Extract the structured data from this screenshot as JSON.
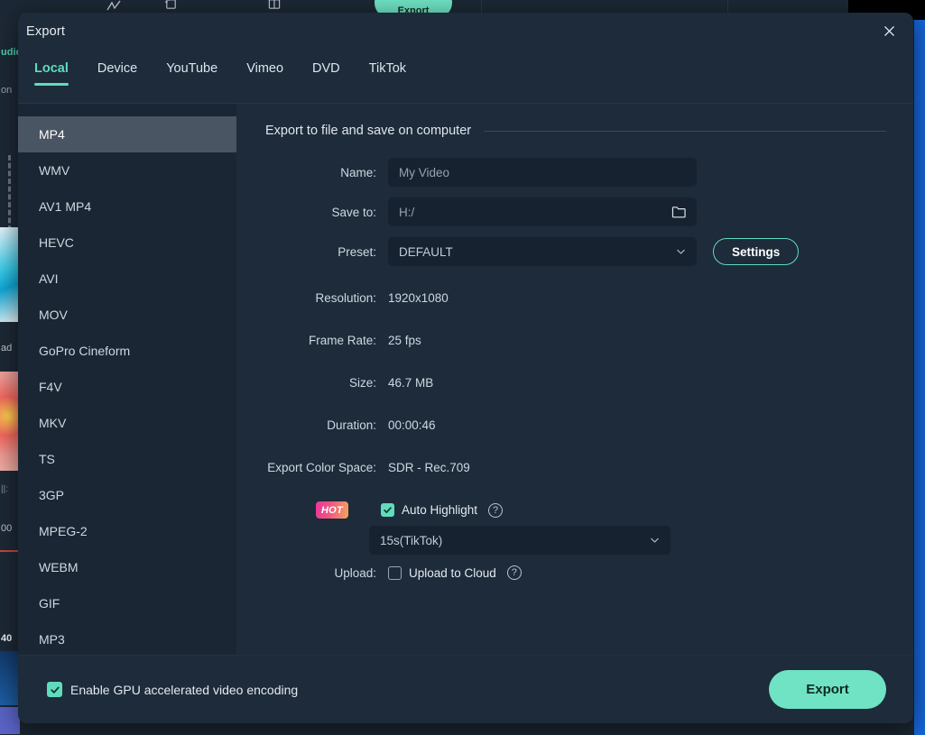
{
  "background": {
    "toolbar_icons": [
      "speed-curve-icon",
      "crop-icon",
      "split-screen-icon"
    ],
    "export_pill_label": "Export",
    "rail": {
      "audio_label": "udio",
      "on_label": "on",
      "ad_label": "ad",
      "bars_label": "||:",
      "time_label": "00",
      "marker_label": "40"
    }
  },
  "dialog": {
    "title": "Export",
    "close_icon": "close-icon"
  },
  "tabs": [
    {
      "label": "Local",
      "active": true
    },
    {
      "label": "Device",
      "active": false
    },
    {
      "label": "YouTube",
      "active": false
    },
    {
      "label": "Vimeo",
      "active": false
    },
    {
      "label": "DVD",
      "active": false
    },
    {
      "label": "TikTok",
      "active": false
    }
  ],
  "formats": [
    {
      "label": "MP4",
      "selected": true
    },
    {
      "label": "WMV",
      "selected": false
    },
    {
      "label": "AV1 MP4",
      "selected": false
    },
    {
      "label": "HEVC",
      "selected": false
    },
    {
      "label": "AVI",
      "selected": false
    },
    {
      "label": "MOV",
      "selected": false
    },
    {
      "label": "GoPro Cineform",
      "selected": false
    },
    {
      "label": "F4V",
      "selected": false
    },
    {
      "label": "MKV",
      "selected": false
    },
    {
      "label": "TS",
      "selected": false
    },
    {
      "label": "3GP",
      "selected": false
    },
    {
      "label": "MPEG-2",
      "selected": false
    },
    {
      "label": "WEBM",
      "selected": false
    },
    {
      "label": "GIF",
      "selected": false
    },
    {
      "label": "MP3",
      "selected": false
    }
  ],
  "panel": {
    "section_title": "Export to file and save on computer",
    "name": {
      "label": "Name:",
      "value": "My Video"
    },
    "save_to": {
      "label": "Save to:",
      "value": "H:/",
      "browse_icon": "folder-icon"
    },
    "preset": {
      "label": "Preset:",
      "value": "DEFAULT",
      "chevron_icon": "chevron-down-icon",
      "settings_button": "Settings"
    },
    "info": [
      {
        "label": "Resolution:",
        "value": "1920x1080"
      },
      {
        "label": "Frame Rate:",
        "value": "25 fps"
      },
      {
        "label": "Size:",
        "value": "46.7 MB"
      },
      {
        "label": "Duration:",
        "value": "00:00:46"
      },
      {
        "label": "Export Color Space:",
        "value": "SDR - Rec.709"
      }
    ],
    "auto_highlight": {
      "badge": "HOT",
      "label": "Auto Highlight",
      "checked": true,
      "help_icon": "help-icon",
      "duration_value": "15s(TikTok)",
      "chevron_icon": "chevron-down-icon"
    },
    "upload": {
      "label": "Upload:",
      "checkbox_label": "Upload to Cloud",
      "checked": false,
      "help_icon": "help-icon"
    }
  },
  "footer": {
    "gpu_label": "Enable GPU accelerated video encoding",
    "gpu_checked": true,
    "export_label": "Export"
  },
  "colors": {
    "accent": "#5fdcbd",
    "export_button": "#6fe3c4",
    "dialog_bg": "#1d2b3a",
    "sidebar_bg": "#1a2633",
    "field_bg": "#172230",
    "selected_item": "#4a5563"
  }
}
